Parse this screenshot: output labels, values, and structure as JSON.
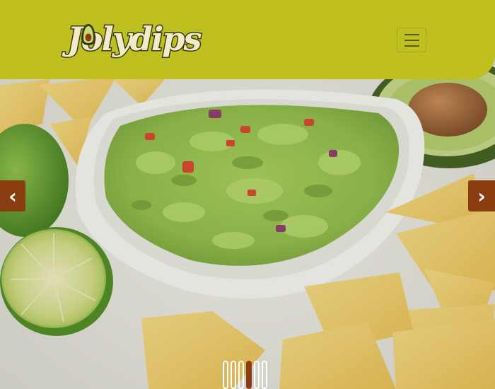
{
  "brand": {
    "logo_text": "Jolydips",
    "header_color": "#bfbf1f",
    "accent_color": "#8a3d10"
  },
  "header": {
    "menu_icon": "hamburger-icon"
  },
  "carousel": {
    "prev_label": "‹",
    "next_label": "›",
    "prev_icon": "chevron-left-icon",
    "next_icon": "chevron-right-icon",
    "slide_count": 6,
    "active_index": 3,
    "slide_image": "guacamole-bowl-with-tortilla-chips-lime-and-avocado"
  }
}
